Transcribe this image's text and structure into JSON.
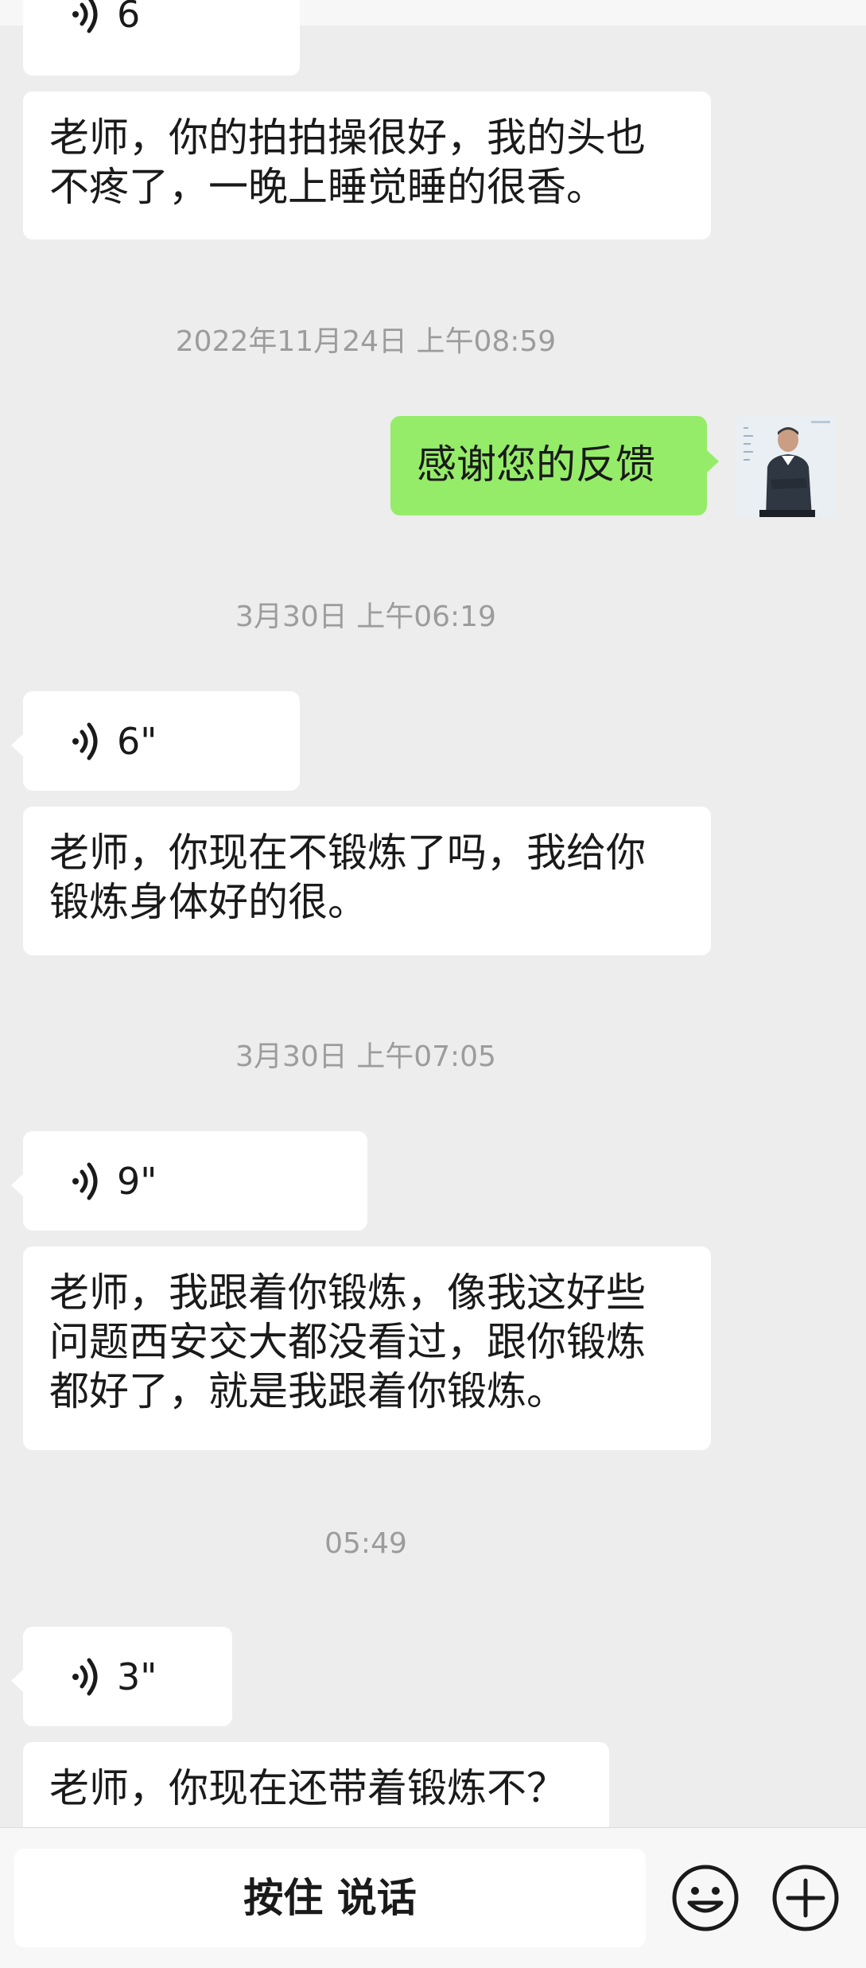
{
  "messages": {
    "top_voice_partial": "6",
    "m1": {
      "line1": "老师，你的拍拍操很好，我的头也",
      "line2": "不疼了，一晚上睡觉睡的很香。"
    },
    "ts1": "2022年11月24日 上午08:59",
    "sent1": "感谢您的反馈",
    "ts2": "3月30日 上午06:19",
    "voice2": "6\"",
    "m2": {
      "line1": "老师，你现在不锻炼了吗，我给你",
      "line2": "锻炼身体好的很。"
    },
    "ts3": "3月30日 上午07:05",
    "voice3": "9\"",
    "m3": {
      "line1": "老师，我跟着你锻炼，像我这好些",
      "line2": "问题西安交大都没看过，跟你锻炼",
      "line3": "都好了，就是我跟着你锻炼。"
    },
    "ts4": "05:49",
    "voice4": "3\"",
    "m4": {
      "line1": "老师，你现在还带着锻炼不？"
    }
  },
  "input_bar": {
    "hold_to_talk": "按住 说话",
    "emoji_icon": "smiley-face-icon",
    "add_icon": "plus-circle-icon"
  },
  "colors": {
    "background": "#ededed",
    "received_bubble": "#ffffff",
    "sent_bubble": "#95ec69",
    "timestamp": "#9c9c9c"
  }
}
